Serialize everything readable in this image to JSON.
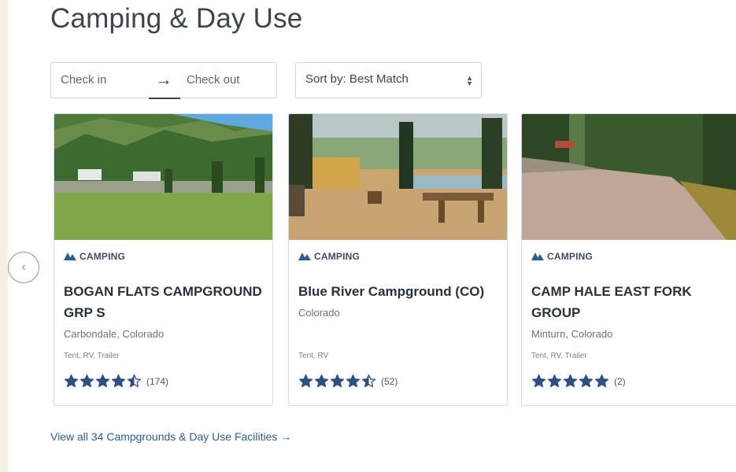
{
  "section": {
    "title": "Camping & Day Use"
  },
  "filters": {
    "check_in": "Check in",
    "check_out": "Check out",
    "sort_label": "Sort by: Best Match"
  },
  "cards": [
    {
      "category": "CAMPING",
      "name": "BOGAN FLATS CAMPGROUND GRP S",
      "location": "Carbondale, Colorado",
      "types": "Tent, RV, Trailer",
      "rating": 4.5,
      "review_count": "(174)"
    },
    {
      "category": "CAMPING",
      "name": "Blue River Campground (CO)",
      "location": "Colorado",
      "types": "Tent, RV",
      "rating": 4.5,
      "review_count": "(52)"
    },
    {
      "category": "CAMPING",
      "name": "CAMP HALE EAST FORK GROUP",
      "location": "Minturn, Colorado",
      "types": "Tent, RV, Trailer",
      "rating": 5,
      "review_count": "(2)"
    }
  ],
  "footer": {
    "view_all": "View all 34 Campgrounds & Day Use Facilities →"
  },
  "colors": {
    "link": "#2b5d9b",
    "star": "#2b4f86",
    "heading": "#3d4550"
  },
  "icons": {
    "prev": "chevron-left-icon",
    "arrow": "arrow-right-icon",
    "sort": "sort-caret-icon",
    "category": "tent-icon",
    "star": "star-icon"
  }
}
